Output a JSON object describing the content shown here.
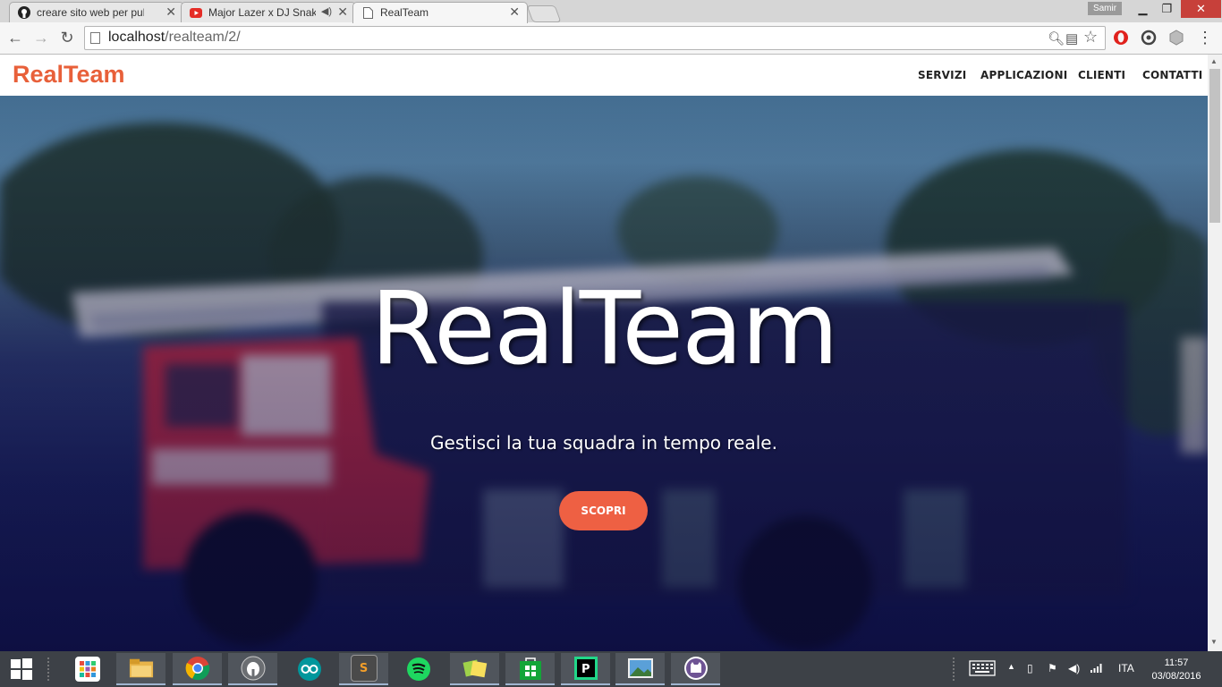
{
  "browser": {
    "tabs": [
      {
        "title": "creare sito web per pubbl",
        "icon": "github-icon",
        "active": false,
        "audio": false
      },
      {
        "title": "Major Lazer x DJ Snake",
        "icon": "youtube-icon",
        "active": false,
        "audio": true
      },
      {
        "title": "RealTeam",
        "icon": "page-icon",
        "active": true,
        "audio": false
      }
    ],
    "profile": "Samir",
    "close_glyph": "✕",
    "url_host": "localhost",
    "url_path": "/realteam/2/"
  },
  "site": {
    "brand": "RealTeam",
    "brand_color": "#e8603a",
    "nav": [
      "SERVIZI",
      "APPLICAZIONI",
      "CLIENTI",
      "CONTATTI"
    ],
    "hero": {
      "title": "RealTeam",
      "subtitle": "Gestisci la tua squadra in tempo reale.",
      "cta": "SCOPRI",
      "cta_color": "#ee6043"
    }
  },
  "taskbar": {
    "apps": [
      "start-grid-icon",
      "file-explorer-icon",
      "chrome-icon",
      "elephant-app-icon",
      "arduino-icon",
      "sublime-text-icon",
      "spotify-icon",
      "notes-app-icon",
      "store-icon",
      "pycharm-icon",
      "photos-icon",
      "github-desktop-icon"
    ],
    "language": "ITA",
    "time": "11:57",
    "date": "03/08/2016"
  }
}
